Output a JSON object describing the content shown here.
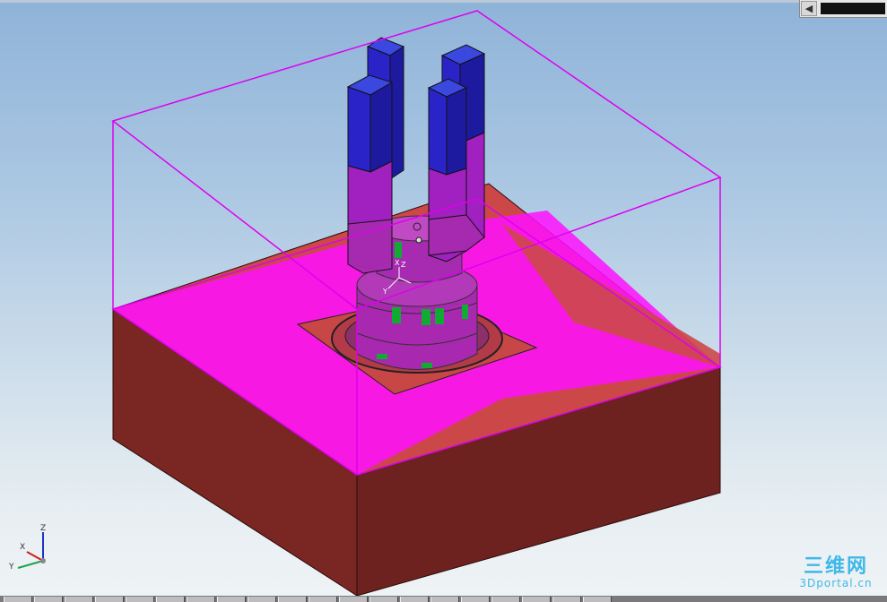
{
  "viewport": {
    "background_top": "#8fb3d8",
    "background_bottom": "#eef3f5"
  },
  "scroll_widget": {
    "left_arrow": "◀"
  },
  "model": {
    "colors": {
      "bounding_box": "#dd00ee",
      "base_top": "#cc4848",
      "base_front": "#6e2220",
      "base_side": "#7a2622",
      "pink_region": "#ff10ff",
      "column_top": "#3344dd",
      "column_upper": "#2a24c8",
      "column_lower": "#a020c0",
      "cylinder": "#a828b0",
      "green_marks": "#11aa33"
    },
    "local_axes": {
      "z": "Z",
      "x": "X",
      "y": "Y"
    }
  },
  "triad": {
    "z": "Z",
    "x": "X",
    "y": "Y",
    "colors": {
      "z": "#1f34c7",
      "x": "#d21b1b",
      "y": "#1aa34a"
    }
  },
  "watermark": {
    "logo": "三维网",
    "site": "3Dportal.cn"
  },
  "taskbar": {
    "item_count": 20
  }
}
